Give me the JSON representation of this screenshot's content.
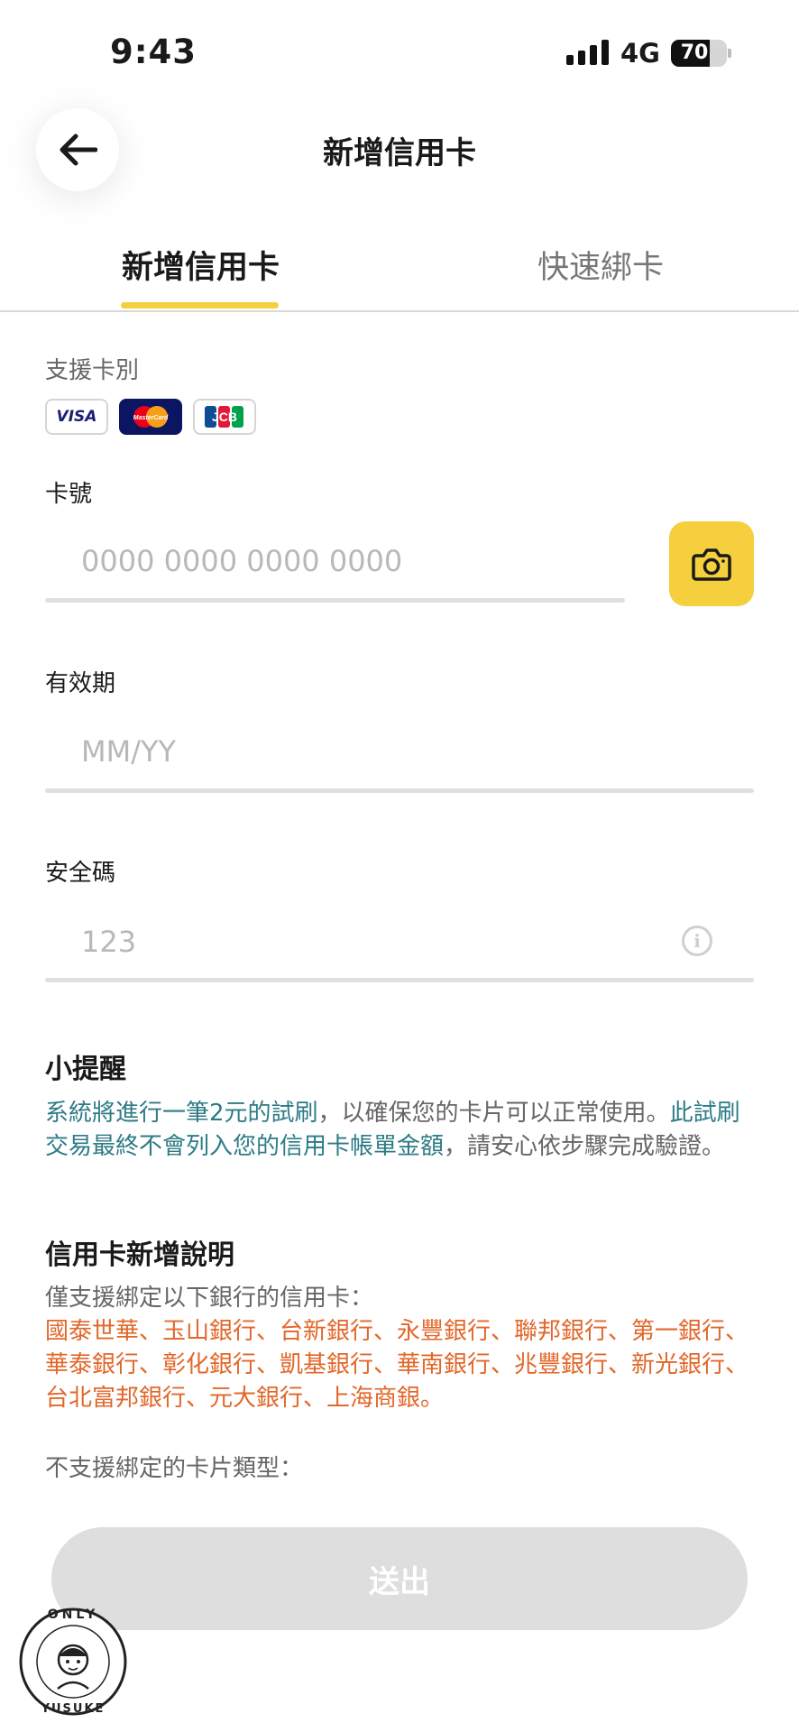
{
  "status_bar": {
    "time": "9:43",
    "network": "4G",
    "battery": "70",
    "battery_level": 0.7
  },
  "header": {
    "title": "新增信用卡",
    "back_icon": "arrow-left-icon"
  },
  "tabs": [
    {
      "label": "新增信用卡",
      "active": true
    },
    {
      "label": "快速綁卡",
      "active": false
    }
  ],
  "supported_cards": {
    "label": "支援卡別",
    "brands": [
      "VISA",
      "MasterCard",
      "JCB"
    ]
  },
  "form": {
    "card_number": {
      "label": "卡號",
      "placeholder": "0000 0000 0000 0000",
      "camera_icon": "camera-icon"
    },
    "expiry": {
      "label": "有效期",
      "placeholder": "MM/YY"
    },
    "cvv": {
      "label": "安全碼",
      "placeholder": "123",
      "info_icon": "info-icon"
    }
  },
  "reminder": {
    "title": "小提醒",
    "part1": "系統將進行一筆2元的試刷",
    "part2": "，以確保您的卡片可以正常使用。",
    "part3": "此試刷交易最終不會列入您的信用卡帳單金額",
    "part4": "，請安心依步驟完成驗證。"
  },
  "instructions": {
    "title": "信用卡新增說明",
    "supported_intro": "僅支援綁定以下銀行的信用卡：",
    "banks": "國泰世華、玉山銀行、台新銀行、永豐銀行、聯邦銀行、第一銀行、華泰銀行、彰化銀行、凱基銀行、華南銀行、兆豐銀行、新光銀行、台北富邦銀行、元大銀行、上海商銀。",
    "unsupported_intro": "不支援綁定的卡片類型："
  },
  "submit": {
    "label": "送出"
  },
  "watermark": {
    "top_text": "ONLY",
    "bottom_text": "YUSUKE"
  },
  "colors": {
    "accent_yellow": "#f5cf3d",
    "teal_text": "#2d7b86",
    "orange_text": "#e2672a",
    "disabled_button": "#dedede"
  }
}
